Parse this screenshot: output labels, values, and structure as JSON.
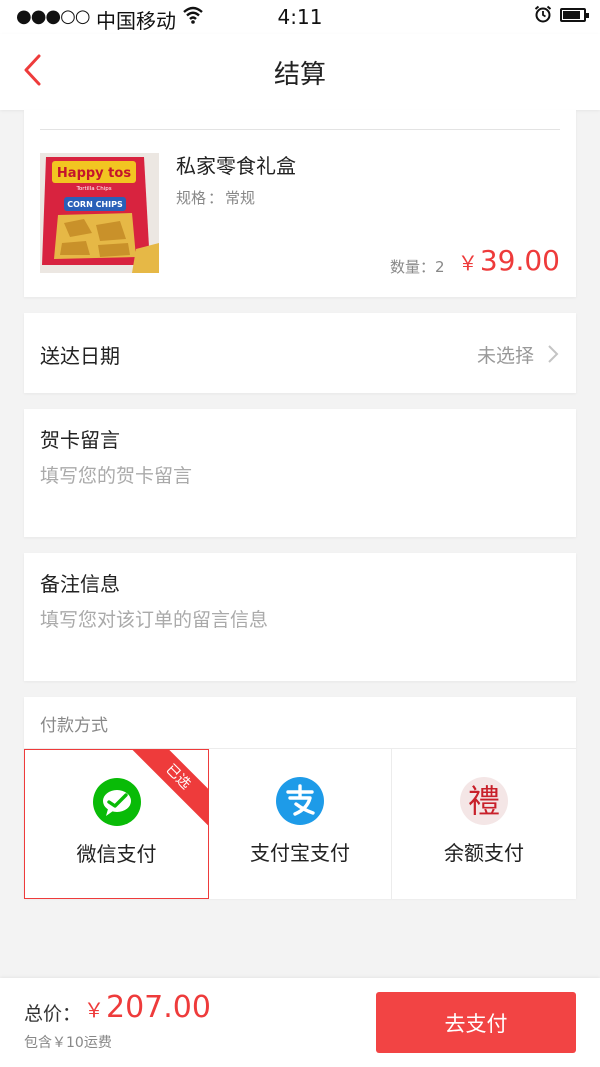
{
  "status_bar": {
    "signal": "●●●○○",
    "carrier": "中国移动",
    "time": "4:11",
    "battery_level": 0.85
  },
  "nav": {
    "title": "结算"
  },
  "product": {
    "name": "私家零食礼盒",
    "spec_label": "规格",
    "spec_sep": "：",
    "spec_value": "常规",
    "qty_label": "数量：",
    "qty_value": "2",
    "currency": "￥",
    "price": "39.00",
    "image_text": {
      "brand": "Happy tos",
      "tagline": "Tortilla Chips",
      "banner": "CORN CHIPS"
    }
  },
  "delivery": {
    "label": "送达日期",
    "value": "未选择"
  },
  "greeting": {
    "label": "贺卡留言",
    "placeholder": "填写您的贺卡留言"
  },
  "note": {
    "label": "备注信息",
    "placeholder": "填写您对该订单的留言信息"
  },
  "payment": {
    "label": "付款方式",
    "selected_badge": "已选",
    "options": [
      {
        "label": "微信支付",
        "icon": "wechat-pay-icon",
        "selected": true,
        "color": "#09bb07"
      },
      {
        "label": "支付宝支付",
        "icon": "alipay-icon",
        "selected": false,
        "color": "#1e9be8"
      },
      {
        "label": "余额支付",
        "icon": "balance-li-icon",
        "selected": false,
        "color": "#c8202a"
      }
    ],
    "balance_glyph": "禮"
  },
  "footer": {
    "total_label": "总价：",
    "currency": "￥",
    "total": "207.00",
    "shipping_note": "包含￥10运费",
    "pay_button": "去支付"
  },
  "colors": {
    "accent": "#ee3b3b",
    "button": "#f24444",
    "background": "#f3f3f3"
  }
}
